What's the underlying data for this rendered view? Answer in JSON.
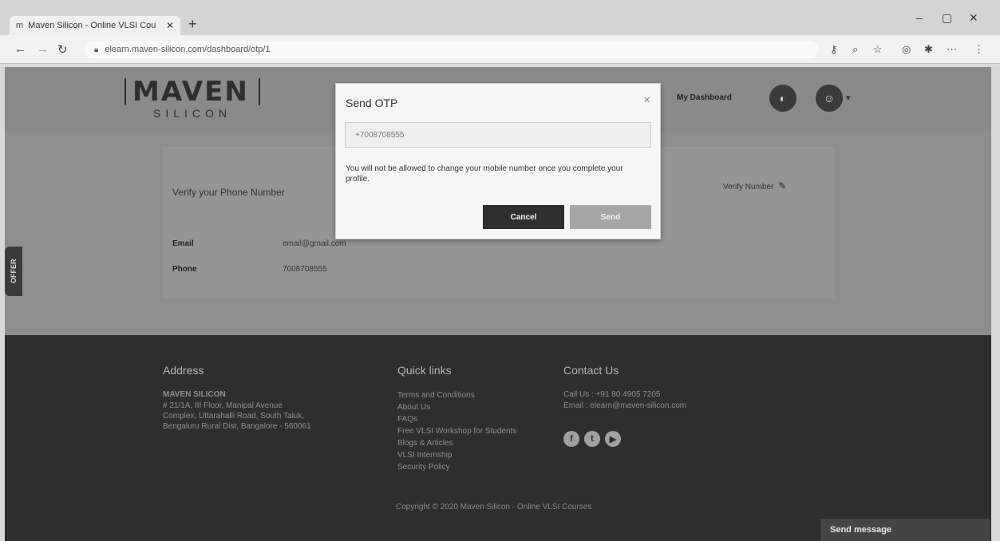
{
  "browser": {
    "tab_title": "Maven Silicon - Online VLSI Cou",
    "tab_favicon": "m",
    "tab_close": "✕",
    "new_tab": "+",
    "url": "elearn.maven-silicon.com/dashboard/otp/1",
    "controls": {
      "minimize": "–",
      "maximize": "▢",
      "close": "✕"
    }
  },
  "header": {
    "logo_main": "MAVEN",
    "logo_sub": "SILICON",
    "dashboard_link": "My Dashboard"
  },
  "profile": {
    "verify_title": "Verify your Phone Number",
    "verify_link": "Verify Number",
    "email_label": "Email",
    "email_value": "email@gmail.com",
    "phone_label": "Phone",
    "phone_value": "7008708555"
  },
  "offer_tab": "OFFER",
  "modal": {
    "title": "Send OTP",
    "close": "×",
    "phone_value": "+7008708555",
    "note": "You will not be allowed to change your mobile number once you complete your profile.",
    "cancel_label": "Cancel",
    "send_label": "Send"
  },
  "footer": {
    "address_title": "Address",
    "company": "MAVEN SILICON",
    "address_lines": [
      "# 21/1A, III Floor, Manipal Avenue",
      "Complex, Uttarahalli Road, South Taluk,",
      "Bengaluru Rural Dist, Bangalore - 560061"
    ],
    "quick_links_title": "Quick links",
    "quick_links": [
      "Terms and Conditions",
      "About Us",
      "FAQs",
      "Free VLSI Workshop for Students",
      "Blogs & Articles",
      "VLSI Internship",
      "Security Policy"
    ],
    "contact_title": "Contact Us",
    "contact_phone": "Call Us : +91 80 4905 7205",
    "contact_email": "Email : elearn@maven-silicon.com",
    "copyright": "Copyright © 2020 Maven Silicon - Online VLSI Courses",
    "chat_label": "Send message"
  }
}
